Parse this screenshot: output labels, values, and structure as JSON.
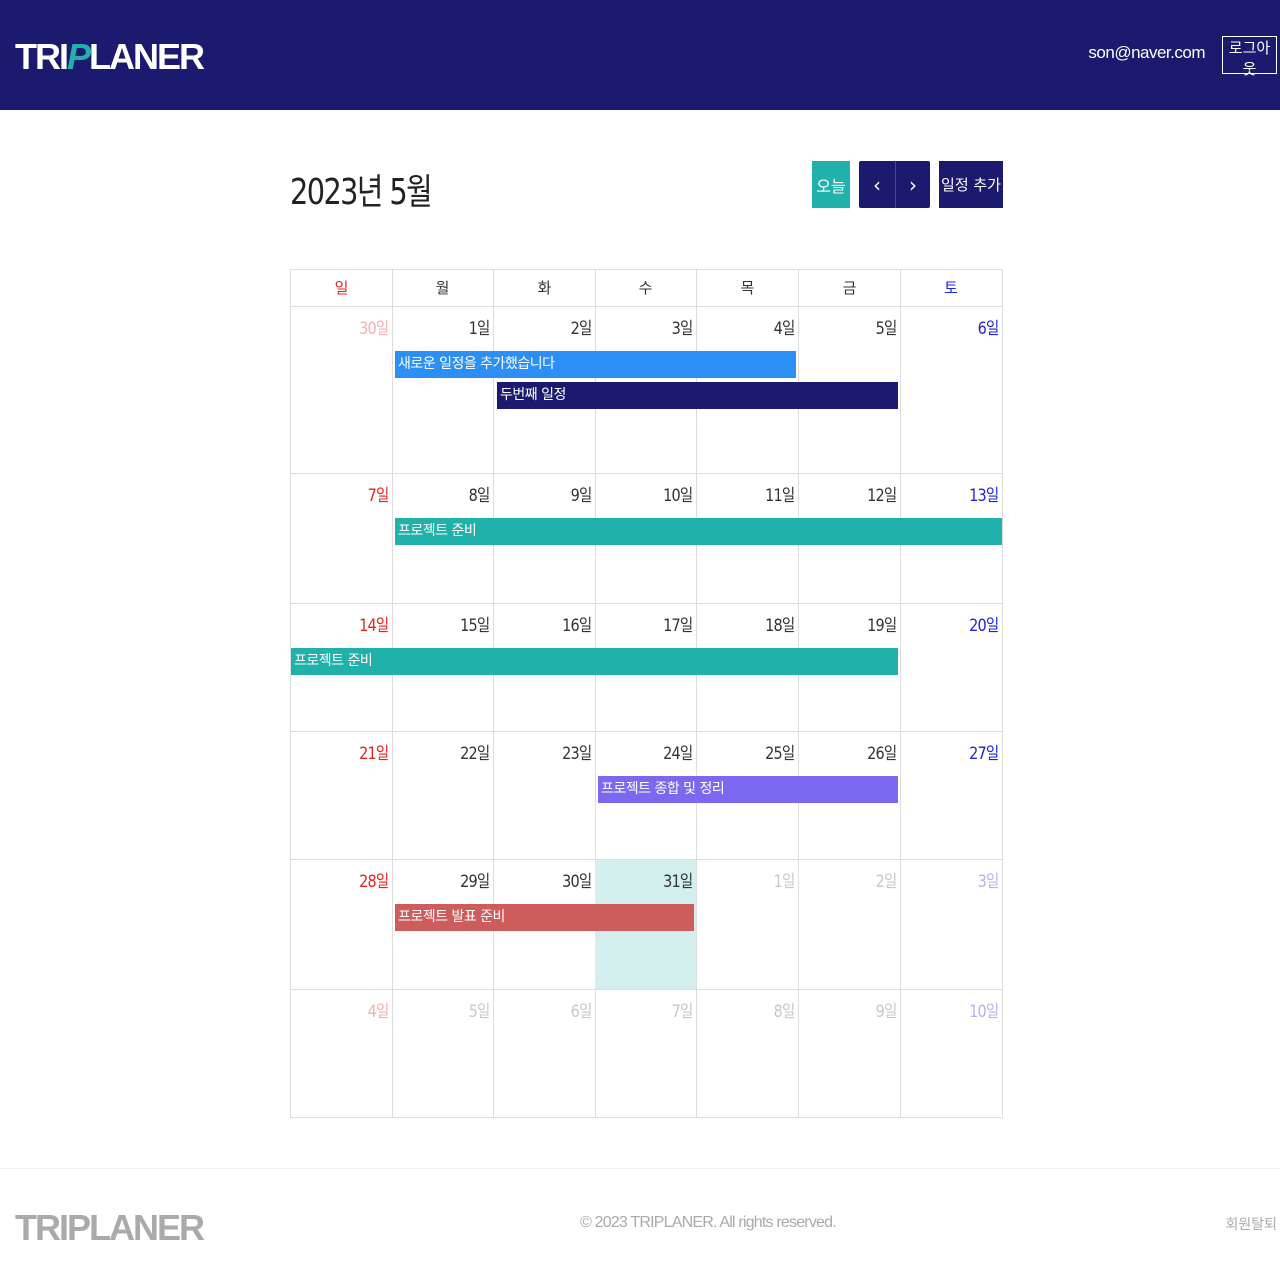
{
  "header": {
    "logo_pre": "TRI",
    "logo_p": "P",
    "logo_post": "LANER",
    "email": "son@naver.com",
    "logout_label": "로그아웃"
  },
  "calendar": {
    "title": "2023년 5월",
    "today_label": "오늘",
    "prev_label": "‹",
    "next_label": "›",
    "add_label": "일정 추가",
    "weekdays": [
      "일",
      "월",
      "화",
      "수",
      "목",
      "금",
      "토"
    ],
    "weeks": [
      [
        "30일",
        "1일",
        "2일",
        "3일",
        "4일",
        "5일",
        "6일"
      ],
      [
        "7일",
        "8일",
        "9일",
        "10일",
        "11일",
        "12일",
        "13일"
      ],
      [
        "14일",
        "15일",
        "16일",
        "17일",
        "18일",
        "19일",
        "20일"
      ],
      [
        "21일",
        "22일",
        "23일",
        "24일",
        "25일",
        "26일",
        "27일"
      ],
      [
        "28일",
        "29일",
        "30일",
        "31일",
        "1일",
        "2일",
        "3일"
      ],
      [
        "4일",
        "5일",
        "6일",
        "7일",
        "8일",
        "9일",
        "10일"
      ]
    ],
    "events": [
      {
        "title": "새로운 일정을 추가했습니다",
        "week": 0,
        "start": 1,
        "span": 4,
        "slot": 0,
        "color": "#2b8ff5"
      },
      {
        "title": "두번째 일정",
        "week": 0,
        "start": 2,
        "span": 4,
        "slot": 1,
        "color": "#1b1a6e"
      },
      {
        "title": "프로젝트 준비",
        "week": 1,
        "start": 1,
        "span": 6,
        "slot": 0,
        "color": "#20b2aa"
      },
      {
        "title": "프로젝트 준비",
        "week": 2,
        "start": 0,
        "span": 6,
        "slot": 0,
        "color": "#20b2aa"
      },
      {
        "title": "프로젝트 종합 및 정리",
        "week": 3,
        "start": 3,
        "span": 3,
        "slot": 0,
        "color": "#7b68ee"
      },
      {
        "title": "프로젝트 발표 준비",
        "week": 4,
        "start": 1,
        "span": 3,
        "slot": 0,
        "color": "#cd5c5c"
      }
    ]
  },
  "footer": {
    "logo": "TRIPLANER",
    "copyright": "© 2023 TRIPLANER. All rights reserved.",
    "withdraw_label": "회원탈퇴"
  },
  "colors": {
    "brand": "#1b1a6e",
    "accent": "#20b2aa",
    "today_bg": "#d3efed",
    "sunday": "#e82222",
    "saturday": "#2222dd"
  }
}
